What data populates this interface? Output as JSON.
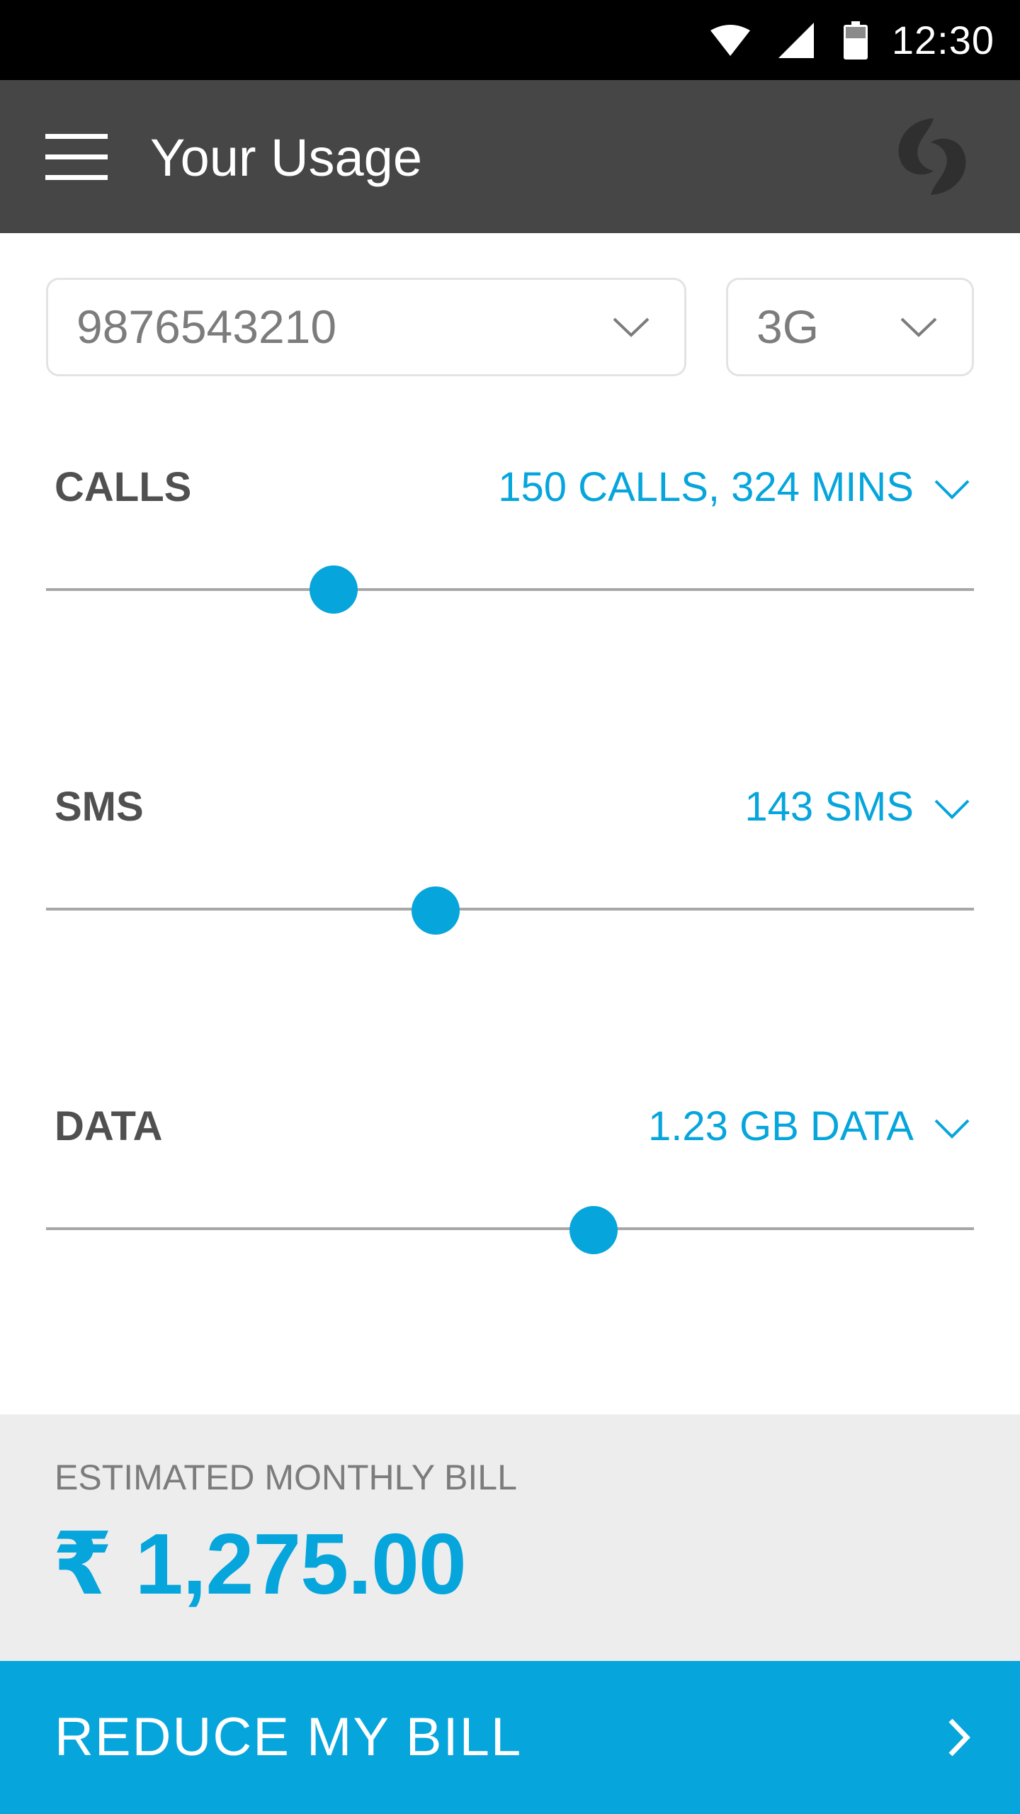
{
  "status_bar": {
    "time": "12:30",
    "icons": [
      "wifi-icon",
      "cell-signal-icon",
      "battery-icon"
    ]
  },
  "app_bar": {
    "title": "Your Usage",
    "menu_icon": "hamburger-menu-icon",
    "logo_icon": "brand-logo-icon"
  },
  "selectors": {
    "number": "9876543210",
    "network": "3G"
  },
  "usage": {
    "calls": {
      "label": "CALLS",
      "value": "150 CALLS, 324 MINS",
      "level": 0.31
    },
    "sms": {
      "label": "SMS",
      "value": "143 SMS",
      "level": 0.42
    },
    "data": {
      "label": "DATA",
      "value": "1.23 GB DATA",
      "level": 0.59
    }
  },
  "bill": {
    "label": "ESTIMATED MONTHLY BILL",
    "amount": "₹ 1,275.00"
  },
  "cta": {
    "label": "REDUCE MY BILL"
  },
  "colors": {
    "accent": "#06a5dc",
    "app_bar": "#464646",
    "status_bar": "#000000",
    "bill_panel": "#ededed"
  }
}
